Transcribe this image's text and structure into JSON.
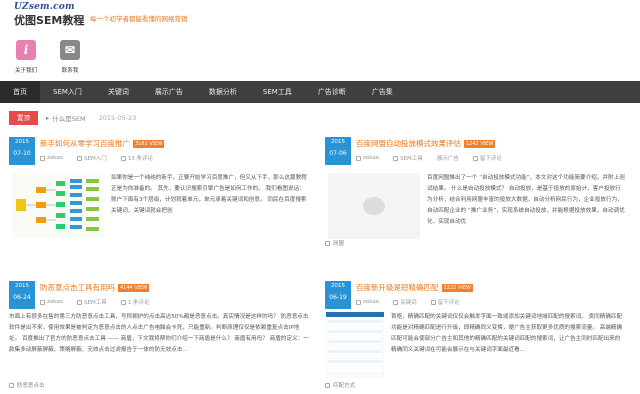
{
  "header": {
    "site": "UZsem.com",
    "name": "优图SEM教程",
    "tagline": "每一个初学者都能看懂的网络营销"
  },
  "shortcuts": [
    {
      "label": "关于我们",
      "glyph": "i",
      "icon": "info-icon"
    },
    {
      "label": "联系我",
      "glyph": "✉",
      "icon": "mail-icon"
    }
  ],
  "nav": [
    "首页",
    "SEM入门",
    "关键词",
    "展示广告",
    "数据分析",
    "SEM工具",
    "广告诊断",
    "广告集"
  ],
  "crumb": {
    "tag": "置顶",
    "text": "什么是SEM",
    "date": "2015-05-23"
  },
  "posts": [
    {
      "month": "2015",
      "day": "07-10",
      "title": "新手如何从零学习百度推广",
      "views": "3162 VIEW",
      "author": "zakao",
      "category": "SEM入门",
      "comments": "13 条评论",
      "text": "如果你是一个纯纯的新手，正要开始学习百度推广，但又从下手，那么这篇教程正是为你准备的。 其先，要认识搜索引擎广告是如何工作的。 我们看图说话：账户下面有3个层级，计划就着单元，单元承着关键词和创意。 同民在百度搜索关键词，关键词就会把创",
      "footer": ""
    },
    {
      "month": "2015",
      "day": "07-06",
      "title": "百度网盟自动投放模式效果评估",
      "views": "1242 VIEW",
      "author": "zakao",
      "category": "SEM工具",
      "comments": "展示广告",
      "extra": "留下评论",
      "text": "百度网盟推出了一个 “自动投放模式功能”，本文对这个功能简要介绍，并附上测试结果。 什么是自动投放模式？ 自动投放，是基于投放的原始计，客户投放行为分析，结合利用网盟丰富的投放大数据，自动分析网民行为，企业投放行为，自动匹配企业的 “推广业务”，实现系统自动投放，并能根据投放效果，自动调优化，实现自动优",
      "footer": "网盟"
    },
    {
      "month": "2015",
      "day": "06-24",
      "title": "防恶意点击工具有用吗",
      "views": "4144 VIEW",
      "author": "zakao",
      "category": "SEM工具",
      "comments": "1 条评论",
      "text": "市面上有很多在售的第三方防恶意点击工具，号称拥护的点击高达50%都是恶意点击。真实情况是这样的吗？ 防恶意点击软件是出不来，使用效果是被判定为恶意点击的人点击广告电脑会卡死，只能重新。判断原理仅仅是依赖重复点击IP地址。 百度推出了官方的防恶意点击工具 —— 商盾，下文我将帮你们介绍一下商盾是什么？ 商盾有用吗？ 商盾的定义：一款集多动屏蔽屏蔽、策略屏蔽、无效点击过滤报告于一体的防无效点击...",
      "footer": "防恶意点击"
    },
    {
      "month": "2015",
      "day": "06-19",
      "title": "百度新升级是短精确匹配",
      "views": "1232 VIEW",
      "author": "zakao",
      "category": "关键词",
      "comments": "留下评论",
      "text": "首枢，精确匹配的关键词仅仅会触发字面一致或添加关键词地域匹配的搜索词。 类同精确匹配功能是对精确匹配进行升级，即精确同义变换，便广告主获取更多优质的搜索流量。 高端精确匹配可能会使部分广告主和其他的精确匹配的关键词匹配的搜索词，让广告主同时匹配出来的精确同义关键词在可能会展示在与关键词字面最近看...",
      "footer": "匹配方式"
    }
  ],
  "colors": {
    "nav_bg": "#3f3f3f",
    "date_bg": "#2a93d5",
    "title": "#e8781e",
    "badge": "#f08030",
    "crumb_tag": "#e84a4a"
  }
}
